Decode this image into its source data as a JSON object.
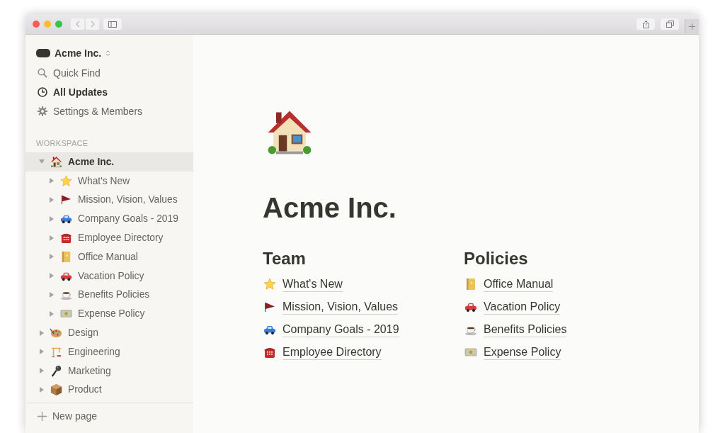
{
  "sidebar": {
    "workspace_name": "Acme Inc.",
    "nav": [
      {
        "label": "Quick Find",
        "selected": false
      },
      {
        "label": "All Updates",
        "selected": true
      },
      {
        "label": "Settings & Members",
        "selected": false
      }
    ],
    "section_label": "WORKSPACE",
    "tree": [
      {
        "label": "Acme Inc.",
        "expanded": true,
        "selected": true,
        "children": [
          {
            "label": "What's New",
            "expanded": false,
            "selected": false
          },
          {
            "label": "Mission, Vision, Values",
            "expanded": false,
            "selected": false
          },
          {
            "label": "Company Goals - 2019",
            "expanded": false,
            "selected": false
          },
          {
            "label": "Employee Directory",
            "expanded": false,
            "selected": false
          },
          {
            "label": "Office Manual",
            "expanded": false,
            "selected": false
          },
          {
            "label": "Vacation Policy",
            "expanded": false,
            "selected": false
          },
          {
            "label": "Benefits Policies",
            "expanded": false,
            "selected": false
          },
          {
            "label": "Expense Policy",
            "expanded": false,
            "selected": false
          }
        ]
      },
      {
        "label": "Design",
        "expanded": false,
        "selected": false
      },
      {
        "label": "Engineering",
        "expanded": false,
        "selected": false
      },
      {
        "label": "Marketing",
        "expanded": false,
        "selected": false
      },
      {
        "label": "Product",
        "expanded": false,
        "selected": false
      }
    ],
    "new_page": "New page"
  },
  "page": {
    "title": "Acme Inc.",
    "columns": [
      {
        "heading": "Team",
        "links": [
          "What's New",
          "Mission, Vision, Values",
          "Company Goals - 2019",
          "Employee Directory"
        ]
      },
      {
        "heading": "Policies",
        "links": [
          "Office Manual",
          "Vacation Policy",
          "Benefits Policies",
          "Expense Policy"
        ]
      }
    ]
  }
}
